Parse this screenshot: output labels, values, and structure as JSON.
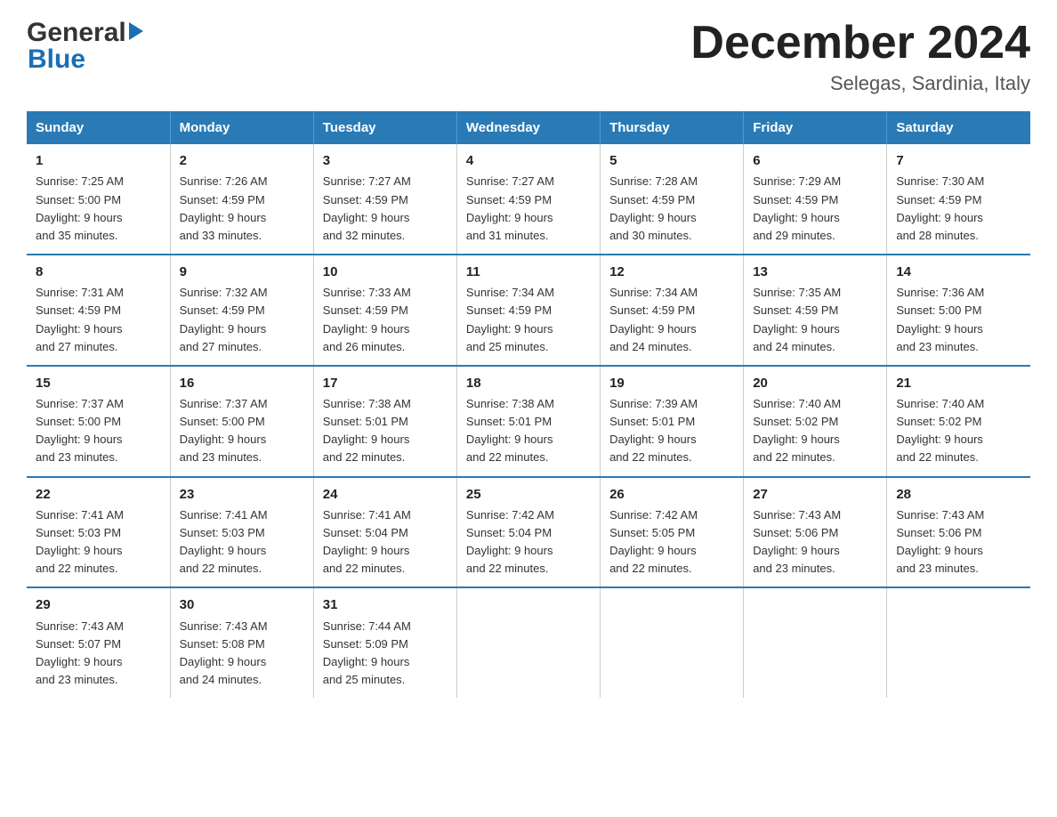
{
  "header": {
    "logo_general": "General",
    "logo_blue": "Blue",
    "title": "December 2024",
    "subtitle": "Selegas, Sardinia, Italy"
  },
  "days_of_week": [
    "Sunday",
    "Monday",
    "Tuesday",
    "Wednesday",
    "Thursday",
    "Friday",
    "Saturday"
  ],
  "weeks": [
    [
      {
        "num": "1",
        "sunrise": "7:25 AM",
        "sunset": "5:00 PM",
        "daylight": "9 hours and 35 minutes."
      },
      {
        "num": "2",
        "sunrise": "7:26 AM",
        "sunset": "4:59 PM",
        "daylight": "9 hours and 33 minutes."
      },
      {
        "num": "3",
        "sunrise": "7:27 AM",
        "sunset": "4:59 PM",
        "daylight": "9 hours and 32 minutes."
      },
      {
        "num": "4",
        "sunrise": "7:27 AM",
        "sunset": "4:59 PM",
        "daylight": "9 hours and 31 minutes."
      },
      {
        "num": "5",
        "sunrise": "7:28 AM",
        "sunset": "4:59 PM",
        "daylight": "9 hours and 30 minutes."
      },
      {
        "num": "6",
        "sunrise": "7:29 AM",
        "sunset": "4:59 PM",
        "daylight": "9 hours and 29 minutes."
      },
      {
        "num": "7",
        "sunrise": "7:30 AM",
        "sunset": "4:59 PM",
        "daylight": "9 hours and 28 minutes."
      }
    ],
    [
      {
        "num": "8",
        "sunrise": "7:31 AM",
        "sunset": "4:59 PM",
        "daylight": "9 hours and 27 minutes."
      },
      {
        "num": "9",
        "sunrise": "7:32 AM",
        "sunset": "4:59 PM",
        "daylight": "9 hours and 27 minutes."
      },
      {
        "num": "10",
        "sunrise": "7:33 AM",
        "sunset": "4:59 PM",
        "daylight": "9 hours and 26 minutes."
      },
      {
        "num": "11",
        "sunrise": "7:34 AM",
        "sunset": "4:59 PM",
        "daylight": "9 hours and 25 minutes."
      },
      {
        "num": "12",
        "sunrise": "7:34 AM",
        "sunset": "4:59 PM",
        "daylight": "9 hours and 24 minutes."
      },
      {
        "num": "13",
        "sunrise": "7:35 AM",
        "sunset": "4:59 PM",
        "daylight": "9 hours and 24 minutes."
      },
      {
        "num": "14",
        "sunrise": "7:36 AM",
        "sunset": "5:00 PM",
        "daylight": "9 hours and 23 minutes."
      }
    ],
    [
      {
        "num": "15",
        "sunrise": "7:37 AM",
        "sunset": "5:00 PM",
        "daylight": "9 hours and 23 minutes."
      },
      {
        "num": "16",
        "sunrise": "7:37 AM",
        "sunset": "5:00 PM",
        "daylight": "9 hours and 23 minutes."
      },
      {
        "num": "17",
        "sunrise": "7:38 AM",
        "sunset": "5:01 PM",
        "daylight": "9 hours and 22 minutes."
      },
      {
        "num": "18",
        "sunrise": "7:38 AM",
        "sunset": "5:01 PM",
        "daylight": "9 hours and 22 minutes."
      },
      {
        "num": "19",
        "sunrise": "7:39 AM",
        "sunset": "5:01 PM",
        "daylight": "9 hours and 22 minutes."
      },
      {
        "num": "20",
        "sunrise": "7:40 AM",
        "sunset": "5:02 PM",
        "daylight": "9 hours and 22 minutes."
      },
      {
        "num": "21",
        "sunrise": "7:40 AM",
        "sunset": "5:02 PM",
        "daylight": "9 hours and 22 minutes."
      }
    ],
    [
      {
        "num": "22",
        "sunrise": "7:41 AM",
        "sunset": "5:03 PM",
        "daylight": "9 hours and 22 minutes."
      },
      {
        "num": "23",
        "sunrise": "7:41 AM",
        "sunset": "5:03 PM",
        "daylight": "9 hours and 22 minutes."
      },
      {
        "num": "24",
        "sunrise": "7:41 AM",
        "sunset": "5:04 PM",
        "daylight": "9 hours and 22 minutes."
      },
      {
        "num": "25",
        "sunrise": "7:42 AM",
        "sunset": "5:04 PM",
        "daylight": "9 hours and 22 minutes."
      },
      {
        "num": "26",
        "sunrise": "7:42 AM",
        "sunset": "5:05 PM",
        "daylight": "9 hours and 22 minutes."
      },
      {
        "num": "27",
        "sunrise": "7:43 AM",
        "sunset": "5:06 PM",
        "daylight": "9 hours and 23 minutes."
      },
      {
        "num": "28",
        "sunrise": "7:43 AM",
        "sunset": "5:06 PM",
        "daylight": "9 hours and 23 minutes."
      }
    ],
    [
      {
        "num": "29",
        "sunrise": "7:43 AM",
        "sunset": "5:07 PM",
        "daylight": "9 hours and 23 minutes."
      },
      {
        "num": "30",
        "sunrise": "7:43 AM",
        "sunset": "5:08 PM",
        "daylight": "9 hours and 24 minutes."
      },
      {
        "num": "31",
        "sunrise": "7:44 AM",
        "sunset": "5:09 PM",
        "daylight": "9 hours and 25 minutes."
      },
      null,
      null,
      null,
      null
    ]
  ],
  "label_sunrise": "Sunrise:",
  "label_sunset": "Sunset:",
  "label_daylight": "Daylight:"
}
